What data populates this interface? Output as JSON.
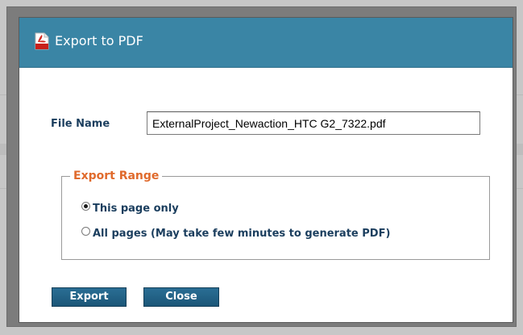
{
  "dialog": {
    "title": "Export to PDF",
    "title_icon": "pdf-file-icon"
  },
  "form": {
    "file_name_label": "File Name",
    "file_name_value": "ExternalProject_Newaction_HTC G2_7322.pdf"
  },
  "export_range": {
    "legend": "Export Range",
    "options": [
      {
        "label": "This page only",
        "checked": true
      },
      {
        "label": "All pages (May take few minutes to generate PDF)",
        "checked": false
      }
    ]
  },
  "buttons": {
    "export_label": "Export",
    "close_label": "Close"
  },
  "colors": {
    "title_bar": "#3a85a5",
    "legend": "#e06a2c",
    "label_text": "#1b3e5e",
    "button": "#1f5f84"
  }
}
